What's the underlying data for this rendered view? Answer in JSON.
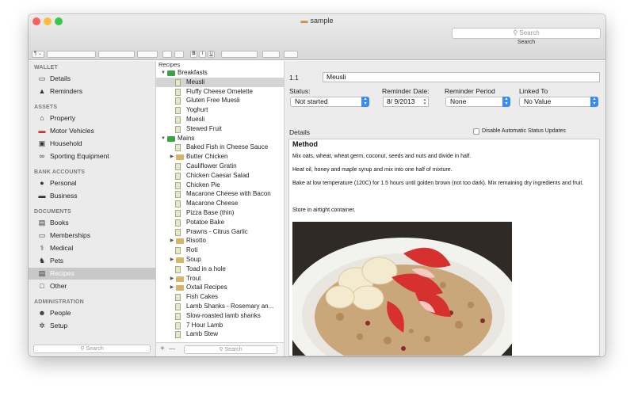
{
  "window": {
    "title": "sample",
    "search_placeholder": "Search",
    "search_caption": "Search"
  },
  "traffic_colors": {
    "close": "#fc605c",
    "minimize": "#fdbc40",
    "zoom": "#34c84a"
  },
  "toolbar": {
    "style_menu": "¶ ⌄",
    "bold": "B",
    "italic": "I",
    "underline": "U"
  },
  "sidebar": {
    "sections": [
      {
        "name": "WALLET"
      },
      {
        "name": "ASSETS"
      },
      {
        "name": "BANK ACCOUNTS"
      },
      {
        "name": "DOCUMENTS"
      },
      {
        "name": "ADMINISTRATION"
      }
    ],
    "items": [
      {
        "label": "Details",
        "icon": "id-card-icon"
      },
      {
        "label": "Reminders",
        "icon": "bell-icon"
      },
      {
        "label": "Property",
        "icon": "house-icon"
      },
      {
        "label": "Motor Vehicles",
        "icon": "car-icon"
      },
      {
        "label": "Household",
        "icon": "tv-icon"
      },
      {
        "label": "Sporting Equipment",
        "icon": "bicycle-icon"
      },
      {
        "label": "Personal",
        "icon": "piggy-bank-icon"
      },
      {
        "label": "Business",
        "icon": "briefcase-icon"
      },
      {
        "label": "Books",
        "icon": "book-icon"
      },
      {
        "label": "Memberships",
        "icon": "membership-card-icon"
      },
      {
        "label": "Medical",
        "icon": "caduceus-icon"
      },
      {
        "label": "Pets",
        "icon": "dog-icon"
      },
      {
        "label": "Recipes",
        "icon": "recipe-book-icon",
        "selected": true
      },
      {
        "label": "Other",
        "icon": "box-icon"
      },
      {
        "label": "People",
        "icon": "people-icon"
      },
      {
        "label": "Setup",
        "icon": "gear-icon"
      }
    ],
    "search_placeholder": "Search"
  },
  "tree": {
    "header": "Recipes",
    "rows": [
      {
        "label": "Breakfasts",
        "kind": "group",
        "expanded": true,
        "level": 0
      },
      {
        "label": "Meusli",
        "kind": "doc",
        "level": 1,
        "selected": true
      },
      {
        "label": "Fluffy Cheese Omelette",
        "kind": "doc",
        "level": 1
      },
      {
        "label": "Gluten Free Muesli",
        "kind": "doc",
        "level": 1
      },
      {
        "label": "Yoghurt",
        "kind": "doc",
        "level": 1
      },
      {
        "label": "Muesli",
        "kind": "doc",
        "level": 1
      },
      {
        "label": "Stewed Fruit",
        "kind": "doc",
        "level": 1
      },
      {
        "label": "Mains",
        "kind": "group",
        "expanded": true,
        "level": 0
      },
      {
        "label": "Baked Fish in Cheese Sauce",
        "kind": "doc",
        "level": 1
      },
      {
        "label": "Butter Chicken",
        "kind": "folder",
        "level": 1
      },
      {
        "label": "Cauliflower Gratin",
        "kind": "doc",
        "level": 1
      },
      {
        "label": "Chicken Caesar Salad",
        "kind": "doc",
        "level": 1
      },
      {
        "label": "Chicken Pie",
        "kind": "doc",
        "level": 1
      },
      {
        "label": "Macarone Cheese with Bacon",
        "kind": "doc",
        "level": 1
      },
      {
        "label": "Macarone Cheese",
        "kind": "doc",
        "level": 1
      },
      {
        "label": "Pizza Base (thin)",
        "kind": "doc",
        "level": 1
      },
      {
        "label": "Potatoe Bake",
        "kind": "doc",
        "level": 1
      },
      {
        "label": "Prawns - Citrus Garlic",
        "kind": "doc",
        "level": 1
      },
      {
        "label": "Risotto",
        "kind": "folder",
        "level": 1
      },
      {
        "label": "Roti",
        "kind": "doc",
        "level": 1
      },
      {
        "label": "Soup",
        "kind": "folder",
        "level": 1
      },
      {
        "label": "Toad in a hole",
        "kind": "doc",
        "level": 1
      },
      {
        "label": "Trout",
        "kind": "folder",
        "level": 1
      },
      {
        "label": "Oxtail Recipes",
        "kind": "folder",
        "level": 1
      },
      {
        "label": "Fish Cakes",
        "kind": "doc",
        "level": 1
      },
      {
        "label": "Lamb Shanks - Rosemary an...",
        "kind": "doc",
        "level": 1
      },
      {
        "label": "Slow-roasted lamb shanks",
        "kind": "doc",
        "level": 1
      },
      {
        "label": "7 Hour Lamb",
        "kind": "doc",
        "level": 1
      },
      {
        "label": "Lamb Stew",
        "kind": "doc",
        "level": 1
      }
    ],
    "add": "+",
    "remove": "—",
    "search_placeholder": "Search"
  },
  "detail": {
    "number": "1.1",
    "name": "Meusli",
    "status_label": "Status:",
    "status_value": "Not started",
    "reminder_date_label": "Reminder Date:",
    "reminder_date_value": "8/ 9/2013",
    "reminder_period_label": "Reminder Period",
    "reminder_period_value": "None",
    "linked_to_label": "Linked To",
    "linked_to_value": "No Value",
    "details_label": "Details",
    "auto_status_label": "Disable Automatic Status Updates",
    "content": {
      "heading": "Method",
      "paragraphs": [
        "Mix oats, wheat, wheat germ, coconut, seeds and nuts and divide in half.",
        "Heat oil, honey and maple syrup and mix into one half of mixture.",
        "Bake at low temperature (120C) for 1.5 hours until golden brown (not too dark).  Mix remaining dry ingredients and fruit.",
        "Store in airtight container."
      ]
    }
  },
  "colors": {
    "folder_green": "#3aa344",
    "folder_tan": "#d8b466",
    "accent_blue": "#3b8cf0"
  }
}
